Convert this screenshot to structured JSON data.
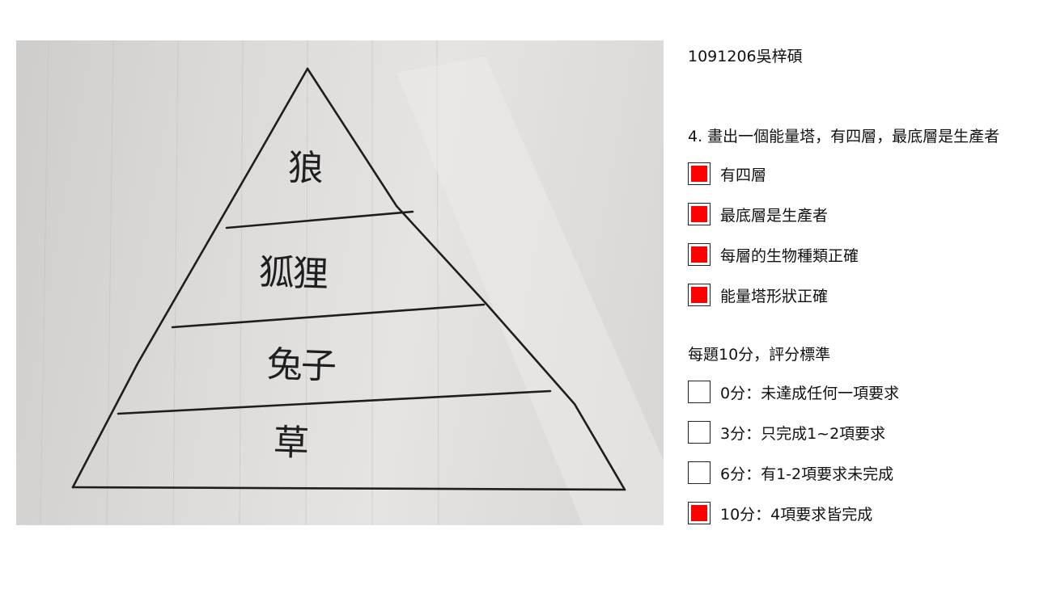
{
  "photo": {
    "handwritten_labels": [
      "狼",
      "狐狸",
      "兔子",
      "草"
    ]
  },
  "rubric": {
    "student": "1091206吳梓碩",
    "question": "4. 畫出一個能量塔，有四層，最底層是生產者",
    "criteria": [
      {
        "label": "有四層",
        "checked": true
      },
      {
        "label": "最底層是生產者",
        "checked": true
      },
      {
        "label": "每層的生物種類正確",
        "checked": true
      },
      {
        "label": "能量塔形狀正確",
        "checked": true
      }
    ],
    "scoring_title": "每題10分，評分標準",
    "scores": [
      {
        "label": "0分：未達成任何一項要求",
        "checked": false
      },
      {
        "label": "3分：只完成1~2項要求",
        "checked": false
      },
      {
        "label": "6分：有1-2項要求未完成",
        "checked": false
      },
      {
        "label": "10分：4項要求皆完成",
        "checked": true
      }
    ],
    "check_color": "#ff0000"
  }
}
